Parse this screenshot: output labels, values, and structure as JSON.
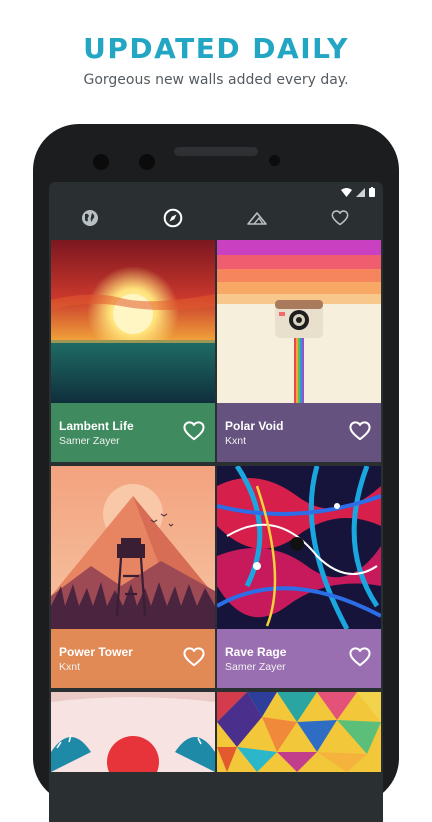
{
  "headline": "UPDATED DAILY",
  "subheadline": "Gorgeous new walls added every day.",
  "tabs": [
    {
      "icon": "globe-icon"
    },
    {
      "icon": "compass-icon",
      "active": true
    },
    {
      "icon": "mountain-icon"
    },
    {
      "icon": "heart-icon"
    }
  ],
  "status_icons": [
    "wifi-icon",
    "signal-icon",
    "battery-icon"
  ],
  "wallpapers": [
    {
      "title": "Lambent Life",
      "author": "Samer Zayer",
      "color": "#3f8a5e"
    },
    {
      "title": "Polar Void",
      "author": "Kxnt",
      "color": "#65527f"
    },
    {
      "title": "Power Tower",
      "author": "Kxnt",
      "color": "#e18a56"
    },
    {
      "title": "Rave Rage",
      "author": "Samer Zayer",
      "color": "#9a6fb1"
    }
  ],
  "colors": {
    "accent": "#22a6c4",
    "screen_bg": "#2a2f31",
    "phone_body": "#1c1d1f"
  }
}
